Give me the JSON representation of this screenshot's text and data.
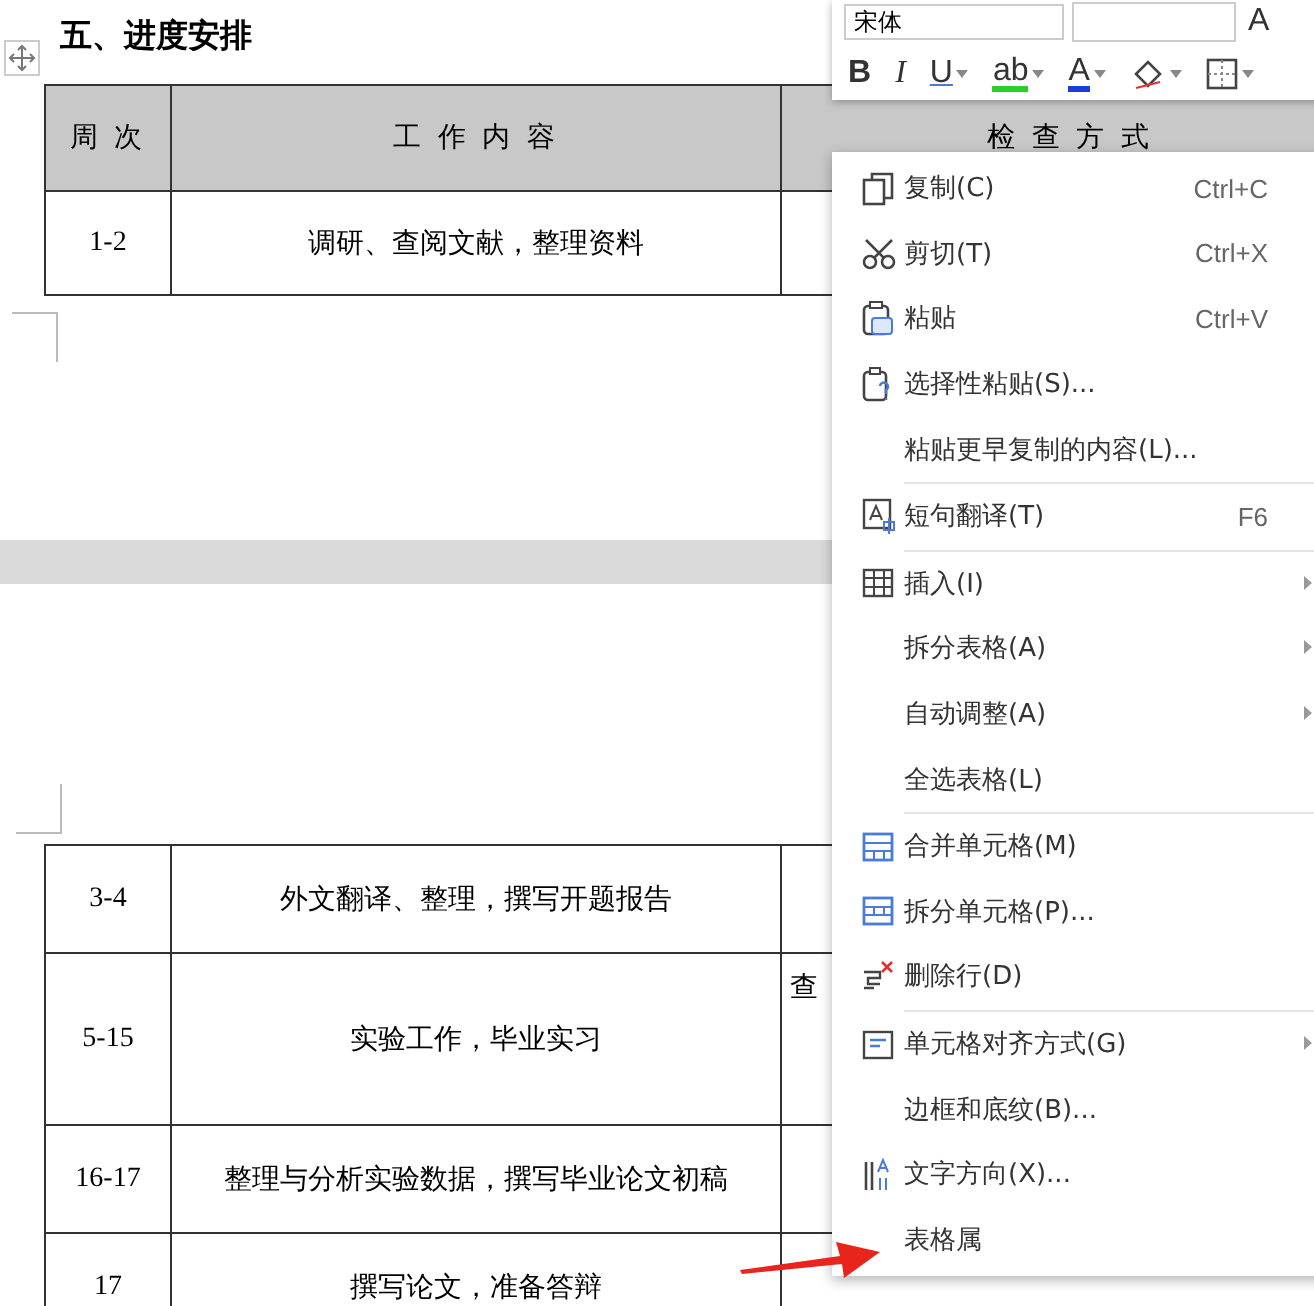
{
  "document": {
    "heading": "五、进度安排",
    "columns": [
      "周 次",
      "工 作 内 容",
      "检 查 方 式"
    ],
    "rows": [
      {
        "week": "1-2",
        "content": "调研、查阅文献，整理资料"
      }
    ],
    "continued_rows": [
      {
        "week": "3-4",
        "content": "外文翻译、整理，撰写开题报告",
        "check": ""
      },
      {
        "week": "5-15",
        "content": "实验工作，毕业实习",
        "check": "查"
      },
      {
        "week": "16-17",
        "content": "整理与分析实验数据，撰写毕业论文初稿",
        "check": ""
      },
      {
        "week": "17",
        "content": "撰写论文，准备答辩",
        "check": ""
      }
    ]
  },
  "toolbar": {
    "font": "宋体",
    "grow": "A",
    "buttons": [
      {
        "kind": "bold",
        "label": "B"
      },
      {
        "kind": "italic",
        "label": "I"
      },
      {
        "kind": "underline",
        "label": "U"
      },
      {
        "kind": "highlight",
        "label": "ab"
      },
      {
        "kind": "font-color",
        "label": "A"
      },
      {
        "kind": "fill"
      },
      {
        "kind": "border"
      }
    ]
  },
  "context_menu": {
    "groups": [
      [
        {
          "label": "复制(C)",
          "shortcut": "Ctrl+C",
          "kind": "copy",
          "submenu": false
        },
        {
          "label": "剪切(T)",
          "shortcut": "Ctrl+X",
          "kind": "cut",
          "submenu": false
        },
        {
          "label": "粘贴",
          "shortcut": "Ctrl+V",
          "kind": "paste",
          "submenu": false
        },
        {
          "label": "选择性粘贴(S)...",
          "kind": "paste-special",
          "submenu": false
        },
        {
          "label": "粘贴更早复制的内容(L)...",
          "kind": "none",
          "submenu": false
        }
      ],
      [
        {
          "label": "短句翻译(T)",
          "shortcut": "F6",
          "kind": "translate",
          "submenu": false
        }
      ],
      [
        {
          "label": "插入(I)",
          "kind": "table",
          "submenu": true
        },
        {
          "label": "拆分表格(A)",
          "kind": "none",
          "submenu": true
        },
        {
          "label": "自动调整(A)",
          "kind": "none",
          "submenu": true
        },
        {
          "label": "全选表格(L)",
          "kind": "none",
          "submenu": false
        }
      ],
      [
        {
          "label": "合并单元格(M)",
          "kind": "merge",
          "submenu": false
        },
        {
          "label": "拆分单元格(P)...",
          "kind": "split",
          "submenu": false
        },
        {
          "label": "删除行(D)",
          "kind": "delete-row",
          "submenu": false
        }
      ],
      [
        {
          "label": "单元格对齐方式(G)",
          "kind": "align",
          "submenu": true
        },
        {
          "label": "边框和底纹(B)...",
          "kind": "none",
          "submenu": false
        },
        {
          "label": "文字方向(X)...",
          "kind": "text-direction",
          "submenu": false
        },
        {
          "label": "表格属",
          "kind": "none",
          "submenu": false
        }
      ]
    ]
  }
}
